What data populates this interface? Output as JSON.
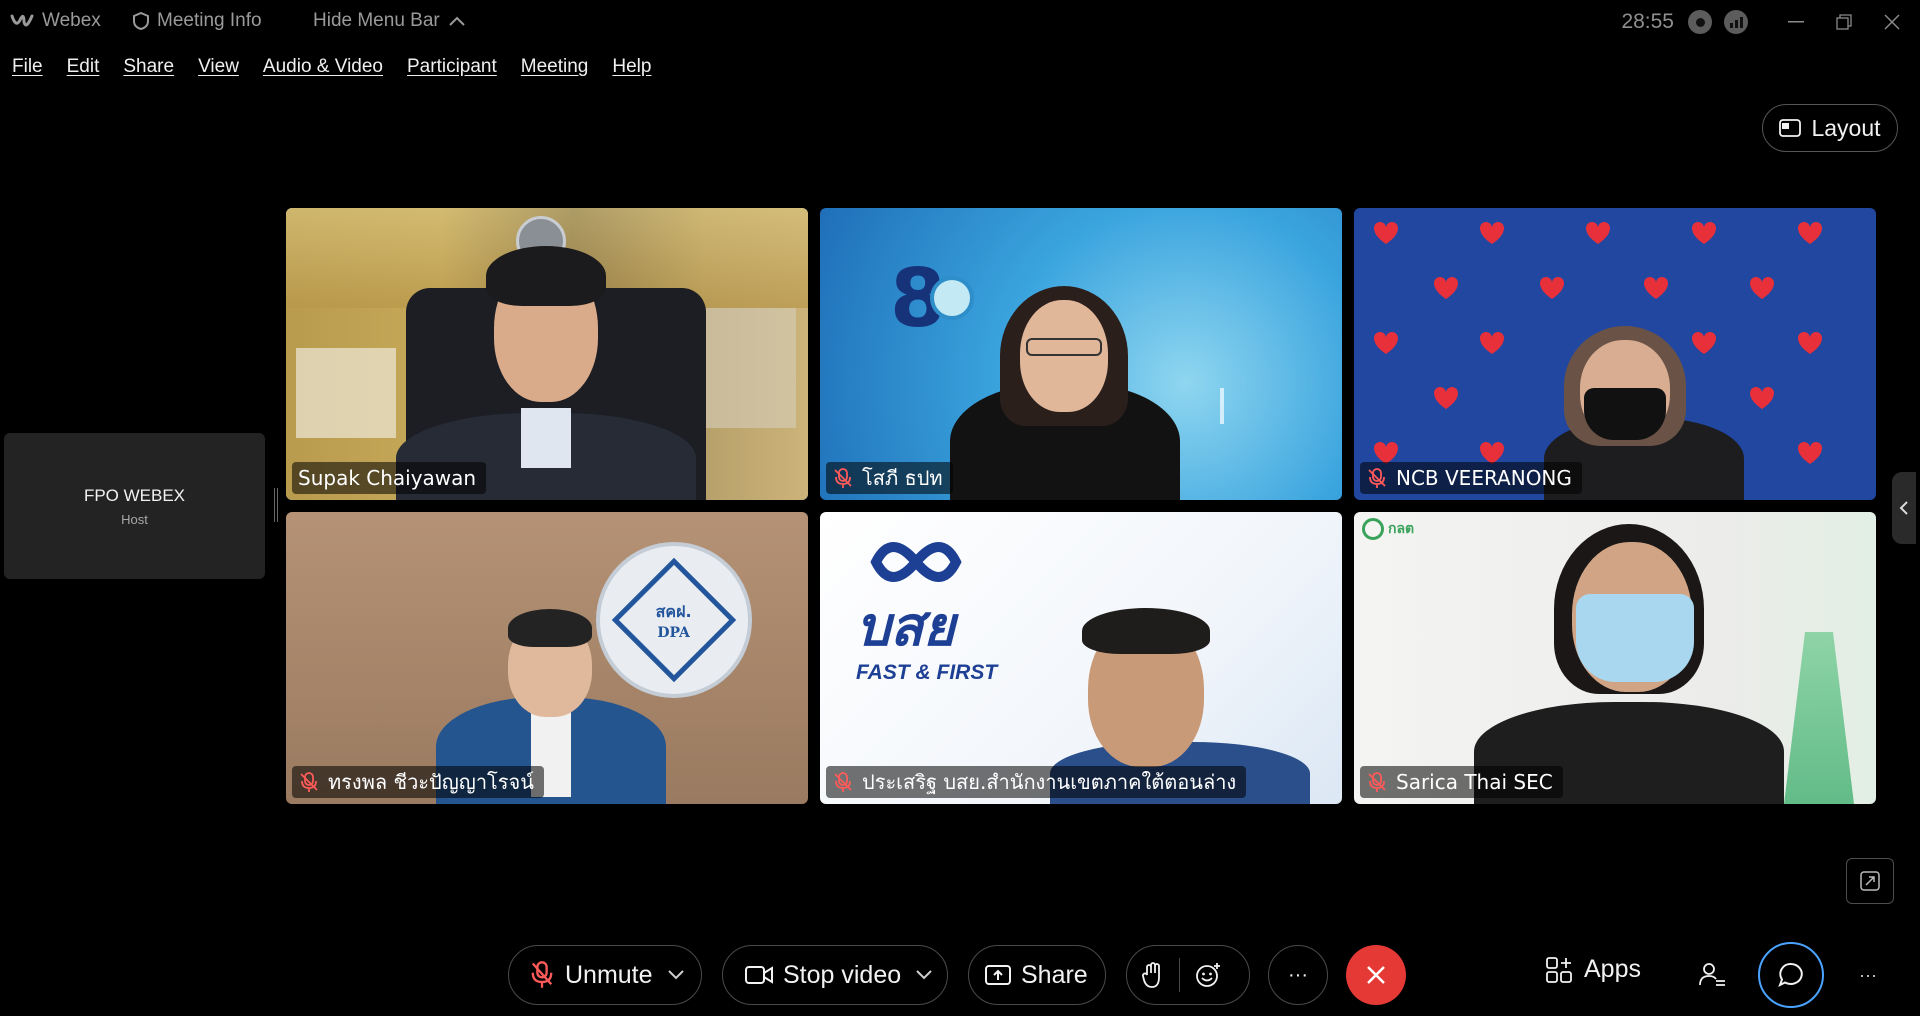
{
  "titlebar": {
    "app_name": "Webex",
    "meeting_info": "Meeting Info",
    "hide_menu": "Hide Menu Bar",
    "timer": "28:55"
  },
  "menu": [
    "File",
    "Edit",
    "Share",
    "View",
    "Audio & Video",
    "Participant",
    "Meeting",
    "Help"
  ],
  "layout_button": "Layout",
  "host": {
    "name": "FPO WEBEX",
    "role": "Host"
  },
  "participants": [
    {
      "name": "Supak Chaiyawan",
      "muted": false,
      "active": true
    },
    {
      "name": "โสภี ธปท",
      "muted": true,
      "active": false
    },
    {
      "name": "NCB VEERANONG",
      "muted": true,
      "active": false
    },
    {
      "name": "ทรงพล ชีวะปัญญาโรจน์",
      "muted": true,
      "active": false
    },
    {
      "name": "ประเสริฐ บสย.สำนักงานเขตภาคใต้ตอนล่าง",
      "muted": true,
      "active": false
    },
    {
      "name": "Sarica Thai SEC",
      "muted": true,
      "active": false
    }
  ],
  "backgrounds": {
    "dpa_seal_name": "สคฝ.",
    "dpa_seal_abbr": "DPA",
    "bsy_logo": "บสย",
    "bsy_tagline": "FAST & FIRST",
    "sec_logo": "กลต"
  },
  "controls": {
    "unmute": "Unmute",
    "stop_video": "Stop video",
    "share": "Share",
    "apps": "Apps",
    "more": "···"
  },
  "colors": {
    "accent": "#4aa3ff",
    "end_call": "#e53935",
    "mute_red": "#ff5a5a"
  }
}
